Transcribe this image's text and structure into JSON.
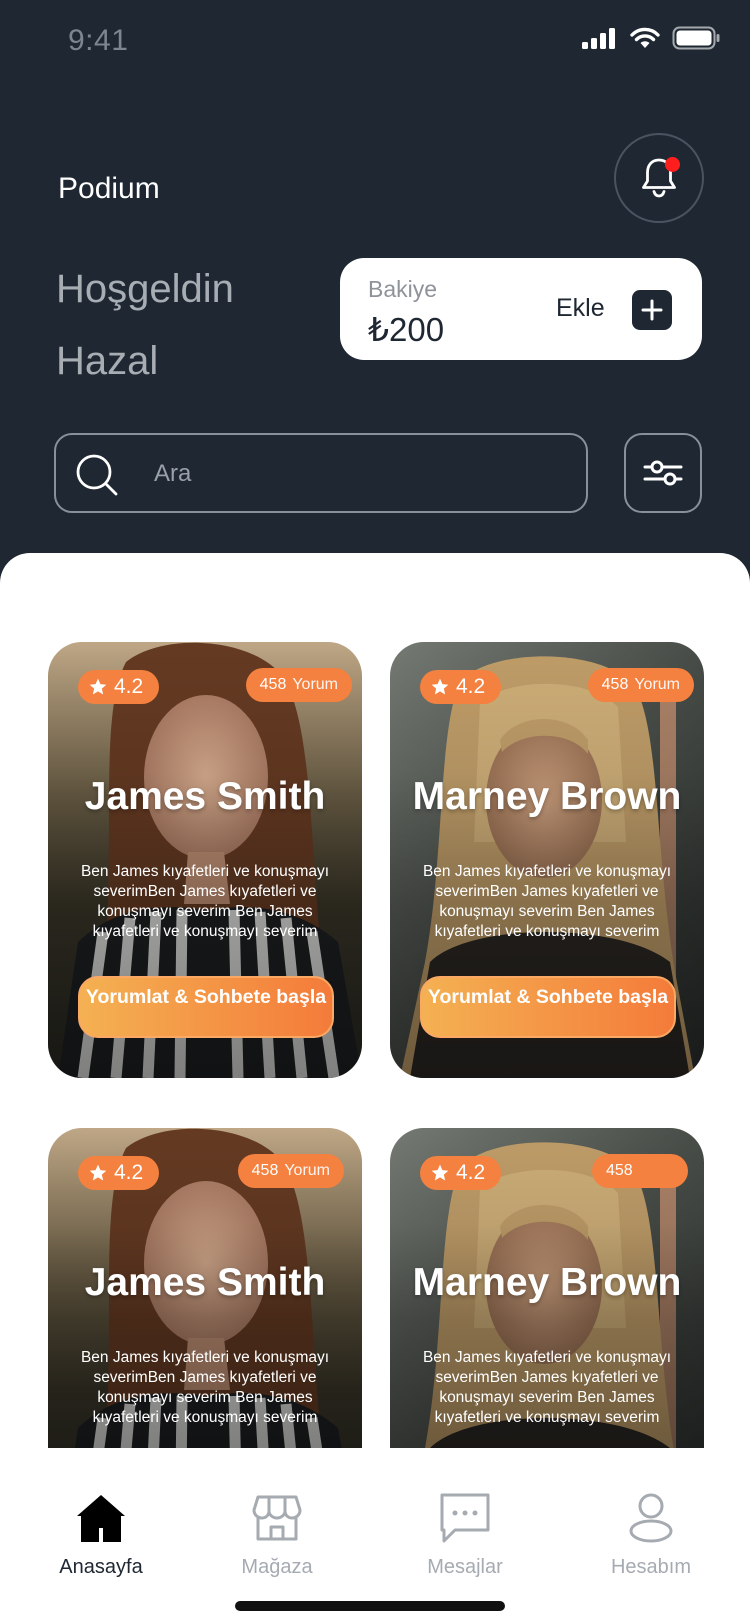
{
  "status_bar": {
    "time": "9:41"
  },
  "header": {
    "brand": "Podium",
    "greeting_line1": "Hoşgeldin",
    "greeting_line2": "Hazal"
  },
  "balance": {
    "label": "Bakiye",
    "amount": "₺200",
    "add_label": "Ekle"
  },
  "search": {
    "placeholder": "Ara"
  },
  "colors": {
    "header_bg": "#1e2732",
    "accent_orange": "#f4813f",
    "button_gradient_start": "#f4b152",
    "button_gradient_end": "#f47b3a",
    "notification_dot": "#ff1e1e"
  },
  "cards": [
    {
      "rating": "4.2",
      "review_count": "458",
      "review_word": "Yorum",
      "name": "James Smith",
      "description": "Ben James kıyafetleri ve konuşmayı severimBen James kıyafetleri ve konuşmayı severim Ben James kıyafetleri ve konuşmayı severim",
      "button": "Yorumlat & Sohbete başla"
    },
    {
      "rating": "4.2",
      "review_count": "458",
      "review_word": "Yorum",
      "name": "Marney Brown",
      "description": "Ben James kıyafetleri ve konuşmayı severimBen James kıyafetleri ve konuşmayı severim Ben James kıyafetleri ve konuşmayı severim",
      "button": "Yorumlat & Sohbete başla"
    },
    {
      "rating": "4.2",
      "review_count": "458",
      "review_word": "Yorum",
      "name": "James Smith",
      "description": "Ben James kıyafetleri ve konuşmayı severimBen James kıyafetleri ve konuşmayı severim Ben James kıyafetleri ve konuşmayı severim"
    },
    {
      "rating": "4.2",
      "review_count": "458",
      "name": "Marney Brown",
      "description": "Ben James kıyafetleri ve konuşmayı severimBen James kıyafetleri ve konuşmayı severim Ben James kıyafetleri ve konuşmayı severim"
    }
  ],
  "tabs": [
    {
      "label": "Anasayfa",
      "icon": "home-icon",
      "active": true
    },
    {
      "label": "Mağaza",
      "icon": "store-icon",
      "active": false
    },
    {
      "label": "Mesajlar",
      "icon": "chat-icon",
      "active": false
    },
    {
      "label": "Hesabım",
      "icon": "user-icon",
      "active": false
    }
  ]
}
